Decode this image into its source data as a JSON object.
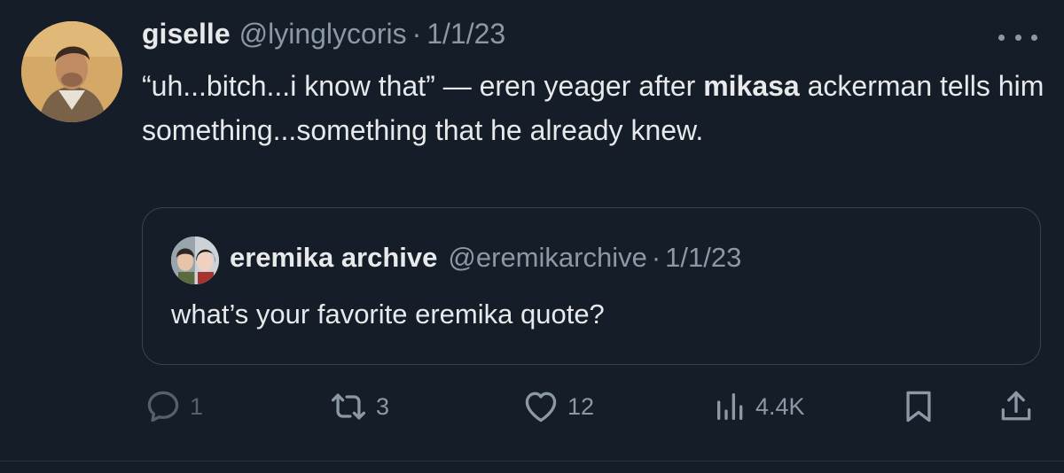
{
  "tweet": {
    "author_name": "giselle",
    "author_handle": "@lyinglycoris",
    "separator": "·",
    "date": "1/1/23",
    "text_before": "“uh...bitch...i know that” — eren yeager after ",
    "text_bold": "mikasa",
    "text_after": " ackerman tells him something...something that he already knew."
  },
  "quote": {
    "author_name": "eremika archive",
    "author_handle": "@eremikarchive",
    "separator": "·",
    "date": "1/1/23",
    "text": "what’s your favorite eremika quote?"
  },
  "actions": {
    "replies": "1",
    "reposts": "3",
    "likes": "12",
    "views": "4.4K"
  },
  "icons": {
    "reply": "speech-bubble-icon",
    "repost": "repost-arrows-icon",
    "like": "heart-icon",
    "views": "bar-chart-icon",
    "bookmark": "bookmark-icon",
    "share": "share-upload-icon",
    "more": "more-dots-icon"
  },
  "colors": {
    "background": "#151d28",
    "text": "#e7e9ea",
    "muted": "#8b98a5",
    "border": "#38444d"
  }
}
